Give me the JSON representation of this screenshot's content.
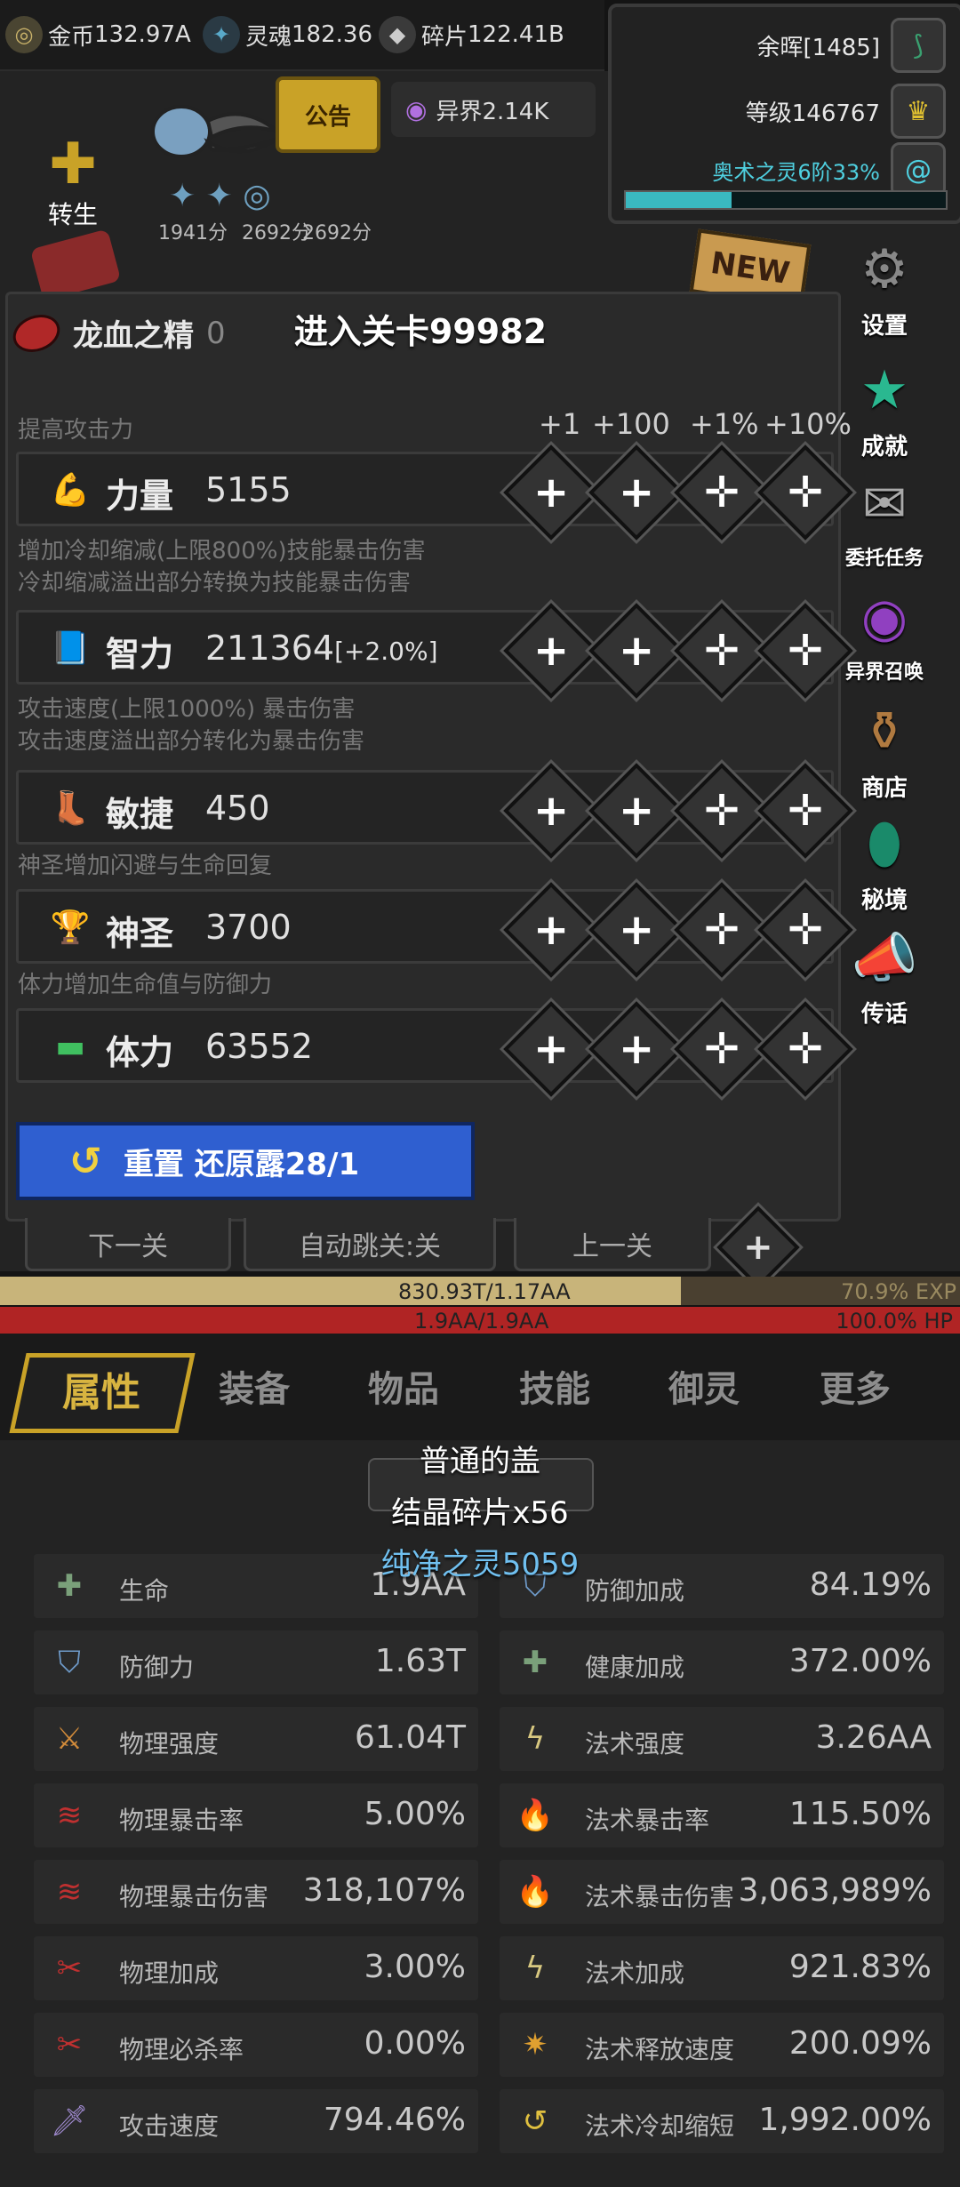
{
  "currencies": [
    {
      "name": "金币",
      "value": "132.97A",
      "icon": "coin-icon",
      "color": "#c9b26a"
    },
    {
      "name": "灵魂",
      "value": "182.36",
      "icon": "soul-icon",
      "color": "#59a9c9"
    },
    {
      "name": "碎片",
      "value": "122.41B",
      "icon": "shard-icon",
      "color": "#c9c9c9"
    }
  ],
  "status": {
    "afterglow": "余晖[1485]",
    "level": "等级146767",
    "arcane": "奥术之灵6阶33%",
    "arcane_progress": 0.33
  },
  "scene": {
    "notice_label": "公告",
    "otherworld": "异界2.14K",
    "rebirth_label": "转生",
    "scores": [
      "1941分",
      "2692分",
      "2692分"
    ],
    "new_badge": "NEW"
  },
  "side_menu": [
    {
      "label": "设置",
      "icon": "gear-icon"
    },
    {
      "label": "成就",
      "icon": "star-icon"
    },
    {
      "label": "委托任务",
      "icon": "scroll-icon"
    },
    {
      "label": "异界召唤",
      "icon": "portal-icon"
    },
    {
      "label": "商店",
      "icon": "shop-icon"
    },
    {
      "label": "秘境",
      "icon": "mirror-icon"
    },
    {
      "label": "传话",
      "icon": "horn-icon"
    }
  ],
  "dialog": {
    "title": "进入关卡99982",
    "essence_name": "龙血之精",
    "essence_value": "0",
    "col_headers": [
      "+1",
      "+100",
      "+1%",
      "+10%"
    ],
    "intro": "提高攻击力",
    "stats": [
      {
        "name": "力量",
        "value": "5155",
        "extra": "",
        "icon": "arm-icon",
        "desc_after": [
          "增加冷却缩减(上限800%)技能暴击伤害",
          "冷却缩减溢出部分转换为技能暴击伤害"
        ]
      },
      {
        "name": "智力",
        "value": "211364",
        "extra": "[+2.0%]",
        "icon": "book-icon",
        "desc_after": [
          "攻击速度(上限1000%) 暴击伤害",
          "攻击速度溢出部分转化为暴击伤害"
        ]
      },
      {
        "name": "敏捷",
        "value": "450",
        "extra": "",
        "icon": "boot-icon",
        "desc_after": [
          "神圣增加闪避与生命回复"
        ]
      },
      {
        "name": "神圣",
        "value": "3700",
        "extra": "",
        "icon": "trophy-icon",
        "desc_after": [
          "体力增加生命值与防御力"
        ]
      },
      {
        "name": "体力",
        "value": "63552",
        "extra": "",
        "icon": "bone-icon",
        "desc_after": []
      }
    ],
    "reset_label": "重置 还原露28/1"
  },
  "nav": {
    "next": "下一关",
    "auto": "自动跳关:关",
    "prev": "上一关"
  },
  "bars": {
    "exp_text": "830.93T/1.17AA",
    "exp_pct": "70.9% EXP",
    "exp_fill": 0.709,
    "hp_text": "1.9AA/1.9AA",
    "hp_pct": "100.0%  HP",
    "hp_fill": 1.0
  },
  "tabs": [
    "属性",
    "装备",
    "物品",
    "技能",
    "御灵",
    "更多"
  ],
  "popup": {
    "line1": "普通的盖",
    "line2": "结晶碎片x56",
    "line3": "纯净之灵5059"
  },
  "attributes": [
    {
      "name": "生命",
      "value": "1.9AA",
      "icon": "cross-icon",
      "color": "#7aa07a"
    },
    {
      "name": "防御加成",
      "value": "84.19%",
      "icon": "shield-icon",
      "color": "#6e9ac9"
    },
    {
      "name": "防御力",
      "value": "1.63T",
      "icon": "shield-icon",
      "color": "#6e9ac9"
    },
    {
      "name": "健康加成",
      "value": "372.00%",
      "icon": "cross-icon",
      "color": "#7aa07a"
    },
    {
      "name": "物理强度",
      "value": "61.04T",
      "icon": "sword-icon",
      "color": "#d08a3a"
    },
    {
      "name": "法术强度",
      "value": "3.26AA",
      "icon": "bolt-icon",
      "color": "#d8c880"
    },
    {
      "name": "物理暴击率",
      "value": "5.00%",
      "icon": "claw-icon",
      "color": "#c03030"
    },
    {
      "name": "法术暴击率",
      "value": "115.50%",
      "icon": "flame-icon",
      "color": "#5aa0e8"
    },
    {
      "name": "物理暴击伤害",
      "value": "318,107%",
      "icon": "claw-icon",
      "color": "#c03030"
    },
    {
      "name": "法术暴击伤害",
      "value": "3,063,989%",
      "icon": "flame-icon",
      "color": "#5aa0e8"
    },
    {
      "name": "物理加成",
      "value": "3.00%",
      "icon": "blade-icon",
      "color": "#c03030"
    },
    {
      "name": "法术加成",
      "value": "921.83%",
      "icon": "bolt-icon",
      "color": "#d8c880"
    },
    {
      "name": "物理必杀率",
      "value": "0.00%",
      "icon": "blade-icon",
      "color": "#c03030"
    },
    {
      "name": "法术释放速度",
      "value": "200.09%",
      "icon": "burst-icon",
      "color": "#e0a030"
    },
    {
      "name": "攻击速度",
      "value": "794.46%",
      "icon": "dagger-icon",
      "color": "#a08ad0"
    },
    {
      "name": "法术冷却缩短",
      "value": "1,992.00%",
      "icon": "refresh-icon",
      "color": "#e0c040"
    }
  ]
}
